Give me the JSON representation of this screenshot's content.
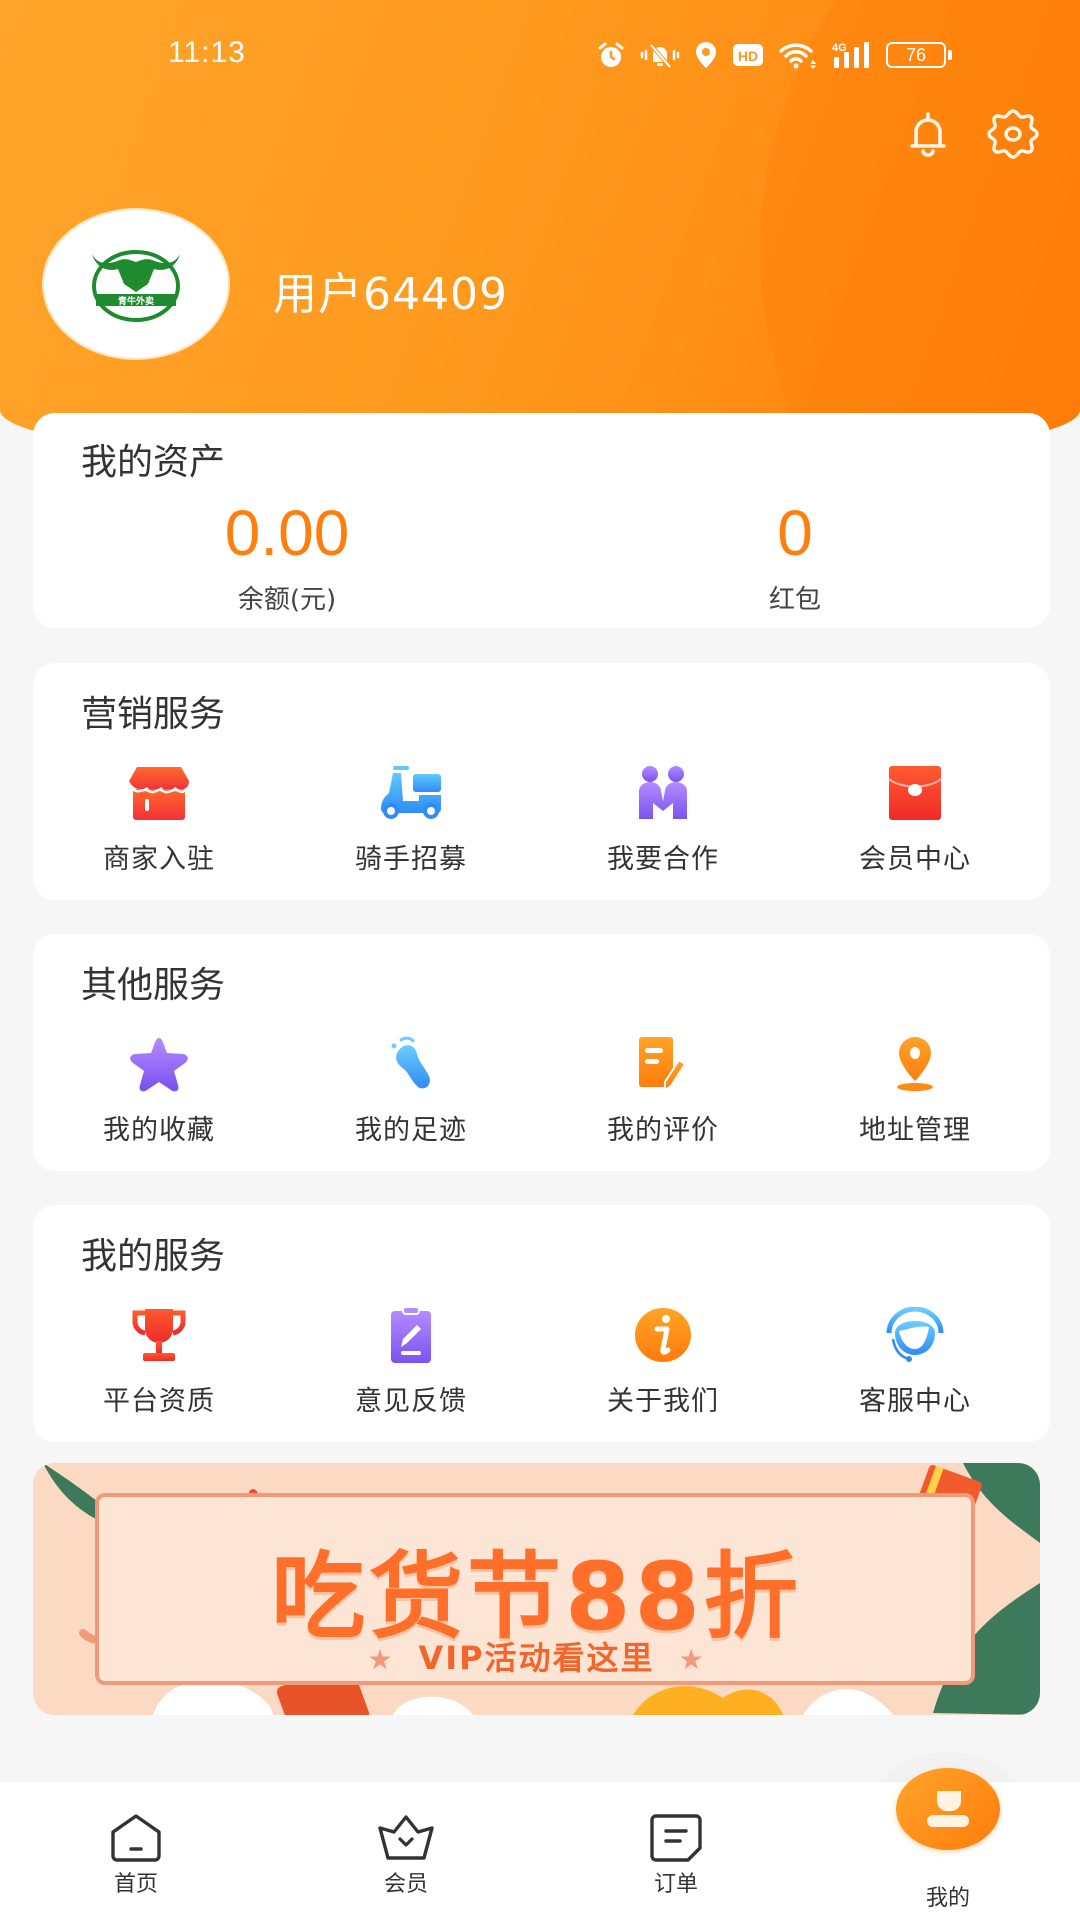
{
  "status_bar": {
    "time": "11:13",
    "battery": "76",
    "network": "4G",
    "icons": [
      "alarm-icon",
      "mute-vibrate-icon",
      "location-icon",
      "hd-icon",
      "wifi-icon",
      "signal-icon",
      "battery-icon"
    ]
  },
  "header": {
    "username": "用户64409",
    "avatar_logo_text": "青牛外卖",
    "actions": [
      "bell-icon",
      "gear-icon"
    ]
  },
  "assets": {
    "title": "我的资产",
    "balance_value": "0.00",
    "balance_label": "余额(元)",
    "redpacket_value": "0",
    "redpacket_label": "红包"
  },
  "marketing": {
    "title": "营销服务",
    "items": [
      {
        "label": "商家入驻",
        "icon": "storefront-icon"
      },
      {
        "label": "骑手招募",
        "icon": "scooter-icon"
      },
      {
        "label": "我要合作",
        "icon": "handshake-people-icon"
      },
      {
        "label": "会员中心",
        "icon": "red-envelope-icon"
      }
    ]
  },
  "other": {
    "title": "其他服务",
    "items": [
      {
        "label": "我的收藏",
        "icon": "star-icon"
      },
      {
        "label": "我的足迹",
        "icon": "footprint-icon"
      },
      {
        "label": "我的评价",
        "icon": "review-edit-icon"
      },
      {
        "label": "地址管理",
        "icon": "location-pin-icon"
      }
    ]
  },
  "mine": {
    "title": "我的服务",
    "items": [
      {
        "label": "平台资质",
        "icon": "trophy-icon"
      },
      {
        "label": "意见反馈",
        "icon": "clipboard-edit-icon"
      },
      {
        "label": "关于我们",
        "icon": "info-icon"
      },
      {
        "label": "客服中心",
        "icon": "headset-icon"
      }
    ]
  },
  "banner": {
    "title": "吃货节88折",
    "subtitle": "VIP活动看这里",
    "tag": "VIP"
  },
  "bottom_nav": {
    "items": [
      {
        "label": "首页",
        "icon": "home-icon"
      },
      {
        "label": "会员",
        "icon": "crown-icon"
      },
      {
        "label": "订单",
        "icon": "order-icon"
      },
      {
        "label": "我的",
        "icon": "user-icon",
        "active": true
      }
    ]
  },
  "colors": {
    "brand_orange": "#ff8a14",
    "value_orange": "#ff7f0e",
    "background": "#f6f6f6"
  }
}
